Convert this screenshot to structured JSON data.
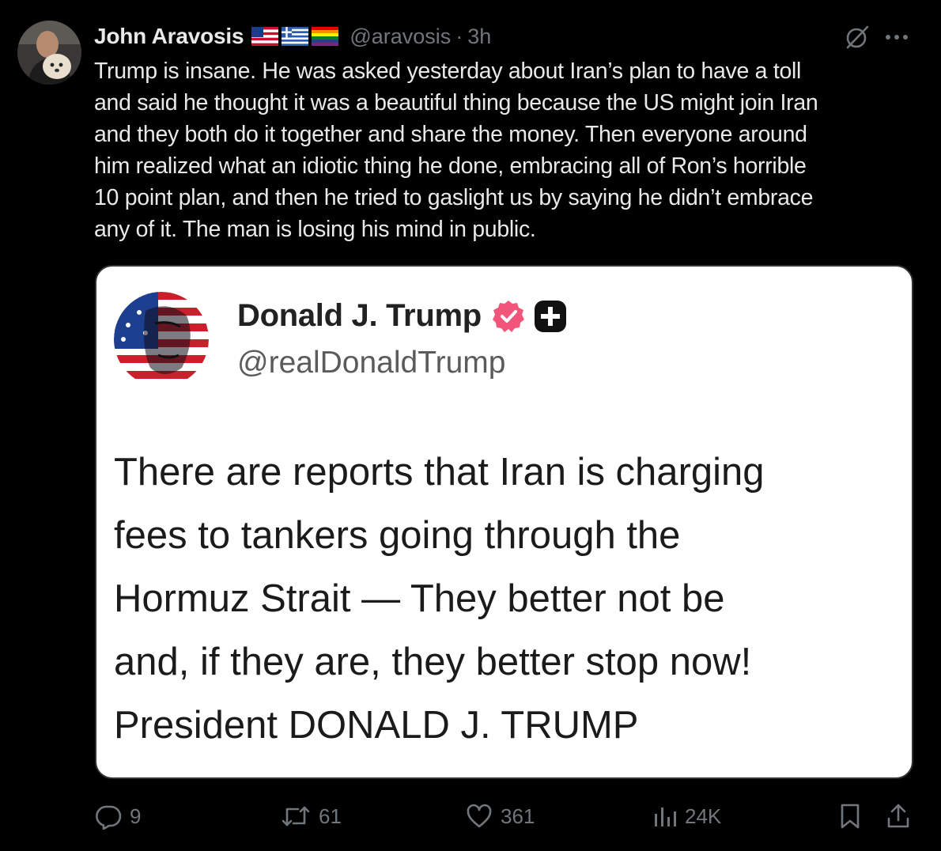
{
  "post": {
    "author": {
      "name": "John Aravosis",
      "handle": "@aravosis",
      "time": "3h",
      "flag_icons": [
        "us-flag-icon",
        "greece-flag-icon",
        "rainbow-flag-icon"
      ]
    },
    "text": "Trump is insane. He was asked yesterday about Iran’s plan to have a toll\nand said he thought it was a beautiful thing because the US might join Iran\nand they both do it together and share the money. Then everyone around\nhim realized what an idiotic thing he done, embracing all of Ron’s horrible\n10 point plan, and then he tried to gaslight us by saying he didn’t embrace\nany of it. The man is losing his mind in public."
  },
  "media": {
    "name": "Donald J. Trump",
    "handle": "@realDonaldTrump",
    "text": "There are reports that Iran is charging\nfees to tankers going through the\nHormuz Strait — They better not be\nand, if they are, they better stop now!\nPresident DONALD J. TRUMP"
  },
  "actions": {
    "replies": "9",
    "reposts": "61",
    "likes": "361",
    "views": "24K"
  },
  "colors": {
    "background": "#000000",
    "text_primary": "#e7e9ea",
    "text_secondary": "#71767b",
    "media_background": "#ffffff",
    "verified_badge": "#f2557a"
  }
}
